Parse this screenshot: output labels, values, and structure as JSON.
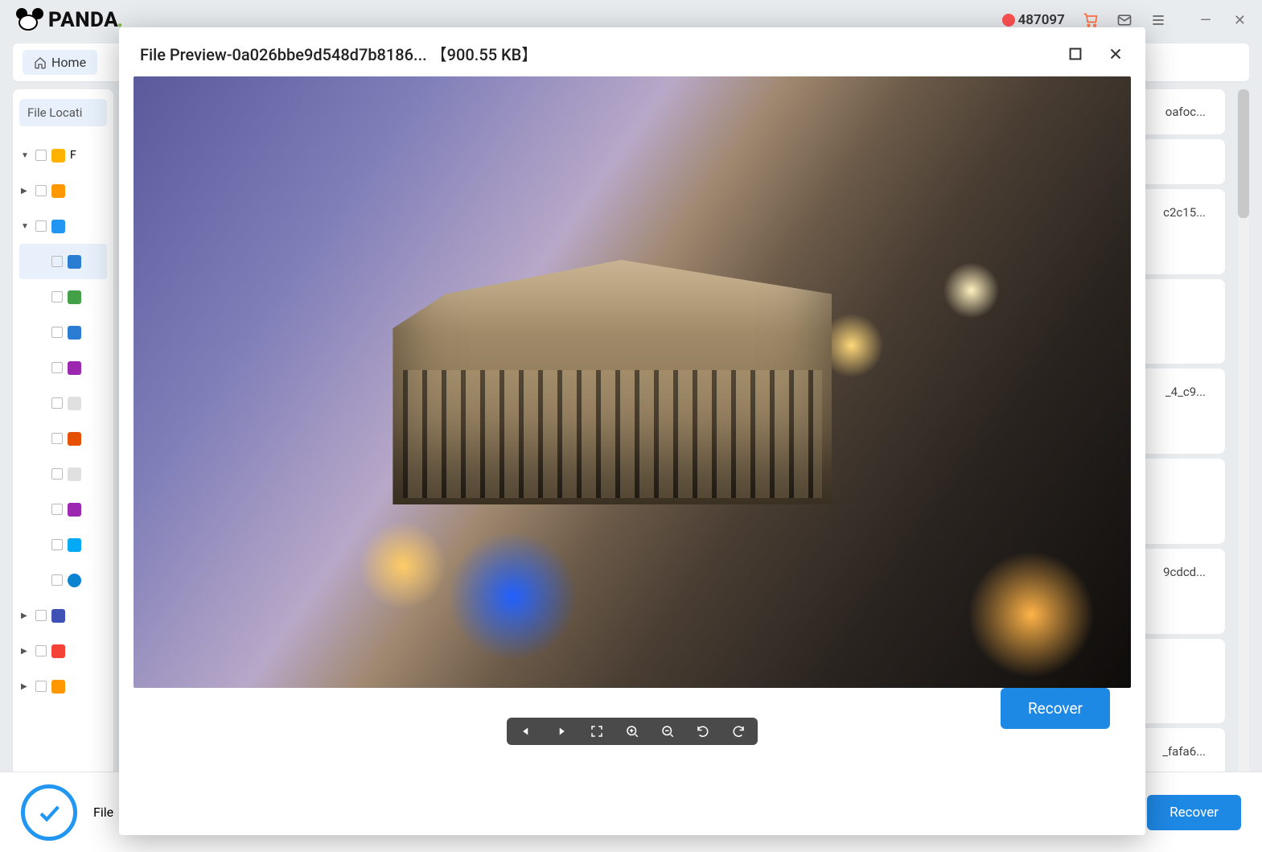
{
  "app": {
    "name": "PANDA",
    "coin_count": "487097"
  },
  "breadcrumb": {
    "home": "Home"
  },
  "sidebar": {
    "file_location": "File Locati",
    "items": [
      {
        "caret": "▼",
        "icon": "folder",
        "label": "F"
      },
      {
        "caret": "▶",
        "icon": "orange",
        "label": ""
      },
      {
        "caret": "▼",
        "icon": "cloud",
        "label": ""
      },
      {
        "caret": "",
        "icon": "docx",
        "label": "",
        "selected": true
      },
      {
        "caret": "",
        "icon": "xlsx",
        "label": ""
      },
      {
        "caret": "",
        "icon": "docx",
        "label": ""
      },
      {
        "caret": "",
        "icon": "purple",
        "label": ""
      },
      {
        "caret": "",
        "icon": "file",
        "label": ""
      },
      {
        "caret": "",
        "icon": "ppt",
        "label": ""
      },
      {
        "caret": "",
        "icon": "file",
        "label": ""
      },
      {
        "caret": "",
        "icon": "purple",
        "label": ""
      },
      {
        "caret": "",
        "icon": "img",
        "label": ""
      },
      {
        "caret": "",
        "icon": "edge",
        "label": ""
      },
      {
        "caret": "▶",
        "icon": "vid",
        "label": ""
      },
      {
        "caret": "▶",
        "icon": "aud",
        "label": ""
      },
      {
        "caret": "▶",
        "icon": "orange",
        "label": ""
      }
    ]
  },
  "rows": [
    "oafoc...",
    "",
    "c2c15...",
    "",
    "_4_c9...",
    "",
    "9cdcd...",
    "",
    "_fafa6..."
  ],
  "bottom": {
    "label_fragment": "File",
    "recover": "Recover"
  },
  "modal": {
    "title": "File Preview-0a026bbe9d548d7b8186... 【900.55 KB】",
    "recover": "Recover"
  }
}
